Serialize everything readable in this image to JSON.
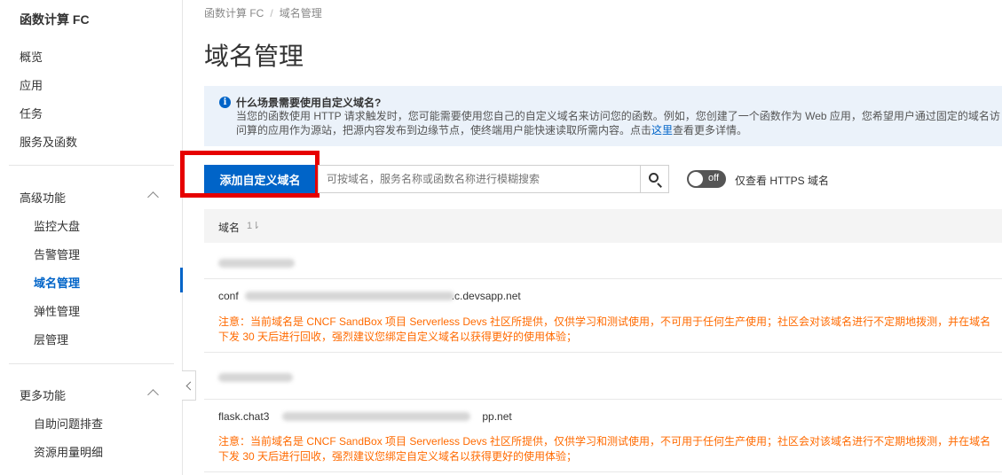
{
  "sidebar": {
    "title": "函数计算 FC",
    "items": [
      "概览",
      "应用",
      "任务",
      "服务及函数"
    ],
    "groups": [
      {
        "label": "高级功能",
        "items": [
          "监控大盘",
          "告警管理",
          "域名管理",
          "弹性管理",
          "层管理"
        ],
        "active": "域名管理"
      },
      {
        "label": "更多功能",
        "items": [
          "自助问题排查",
          "资源用量明细"
        ]
      }
    ]
  },
  "breadcrumb": [
    "函数计算 FC",
    "域名管理"
  ],
  "page_title": "域名管理",
  "info": {
    "title": "什么场景需要使用自定义域名?",
    "body_prefix": "当您的函数使用 HTTP 请求触发时，您可能需要使用您自己的自定义域名来访问您的函数。例如，您创建了一个函数作为 Web 应用，您希望用户通过固定的域名访问算的应用作为源站，把源内容发布到边缘节点，使终端用户能快速读取所需内容。点击",
    "link": "这里",
    "body_suffix": "查看更多详情。"
  },
  "toolbar": {
    "add_label": "添加自定义域名",
    "search_placeholder": "可按域名，服务名称或函数名称进行模糊搜索",
    "toggle_text": "off",
    "toggle_label": "仅查看 HTTPS 域名"
  },
  "table": {
    "col_domain": "域名",
    "sort_glyph": "1⇂",
    "rows": [
      {
        "domain": "conf",
        "domain_tail": ".c.devsapp.net",
        "warning": "注意：当前域名是 CNCF SandBox 项目 Serverless Devs 社区所提供，仅供学习和测试使用，不可用于任何生产使用；社区会对该域名进行不定期地拨测，并在域名下发 30 天后进行回收，强烈建议您绑定自定义域名以获得更好的使用体验；"
      },
      {
        "domain": "flask.chat3",
        "domain_tail": "pp.net",
        "warning": "注意：当前域名是 CNCF SandBox 项目 Serverless Devs 社区所提供，仅供学习和测试使用，不可用于任何生产使用；社区会对该域名进行不定期地拨测，并在域名下发 30 天后进行回收，强烈建议您绑定自定义域名以获得更好的使用体验；"
      }
    ]
  }
}
